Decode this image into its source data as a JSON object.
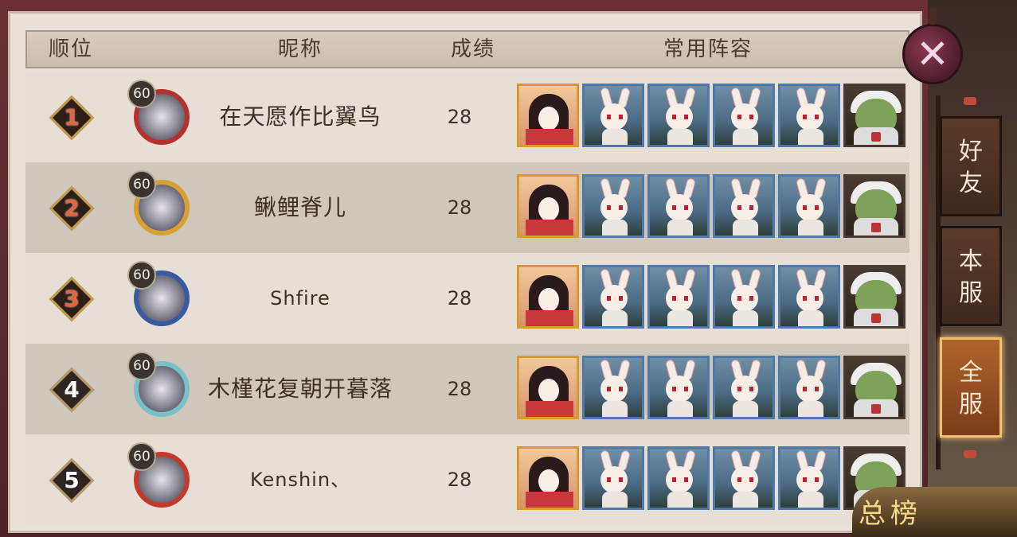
{
  "header": {
    "rank_label": "顺位",
    "nickname_label": "昵称",
    "score_label": "成绩",
    "team_label": "常用阵容"
  },
  "rows": [
    {
      "rank": "1",
      "level": "60",
      "nickname": "在天愿作比翼鸟",
      "score": "28"
    },
    {
      "rank": "2",
      "level": "60",
      "nickname": "鳅鲤脊儿",
      "score": "28"
    },
    {
      "rank": "3",
      "level": "60",
      "nickname": "Shfire",
      "score": "28"
    },
    {
      "rank": "4",
      "level": "60",
      "nickname": "木槿花复朝开暮落",
      "score": "28"
    },
    {
      "rank": "5",
      "level": "60",
      "nickname": "Kenshin、",
      "score": "28"
    }
  ],
  "team_icons": [
    "shikigami-umbrella-girl-icon",
    "shikigami-rabbit-icon",
    "shikigami-rabbit-icon",
    "shikigami-rabbit-icon",
    "shikigami-rabbit-icon",
    "shikigami-frog-icon"
  ],
  "tabs": {
    "friends": [
      "好",
      "友"
    ],
    "server": [
      "本",
      "服"
    ],
    "all_server": [
      "全",
      "服"
    ]
  },
  "active_tab": "all_server",
  "close_icon": "close-icon",
  "emblem_text": "总榜",
  "colors": {
    "panel": "#e9e1d8",
    "row_odd": "#cfc6bc",
    "row_even": "#e7dfd6",
    "accent_gold": "#d99a2e",
    "top_rank_number": "#e8633a"
  }
}
